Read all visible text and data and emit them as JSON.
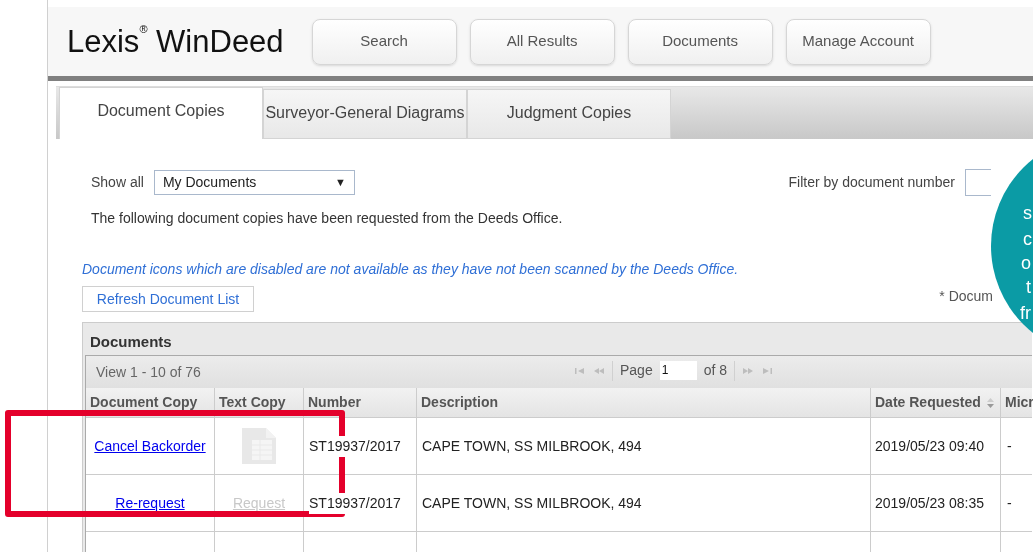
{
  "logo": {
    "name": "Lexis",
    "mark": "®",
    "product": "WinDeed"
  },
  "nav_buttons": [
    "Search",
    "All Results",
    "Documents",
    "Manage Account"
  ],
  "tabs": [
    {
      "label": "Document Copies",
      "selected": true
    },
    {
      "label": "Surveyor-General Diagrams",
      "selected": false
    },
    {
      "label": "Judgment Copies",
      "selected": false
    }
  ],
  "show_all": {
    "label": "Show all",
    "value": "My Documents",
    "caret": "▼"
  },
  "filter": {
    "label": "Filter by document number"
  },
  "intro": "The following document copies have been requested from the Deeds Office.",
  "note": "Document icons which are disabled are not available as they have not been scanned by the Deeds Office.",
  "refresh_button": "Refresh Document List",
  "documents_note": "* Docum",
  "panel": {
    "title": "Documents",
    "view_range": "View 1 - 10 of 76",
    "page_label": "Page",
    "page_value": "1",
    "page_count": "of 8"
  },
  "columns": [
    {
      "label": "Document Copy",
      "sortable": false
    },
    {
      "label": "Text Copy",
      "sortable": false
    },
    {
      "label": "Number",
      "sortable": false
    },
    {
      "label": "Description",
      "sortable": false
    },
    {
      "label": "Date Requested",
      "sortable": true
    },
    {
      "label": "Micr"
    }
  ],
  "rows": [
    {
      "document_copy": "Cancel Backorder",
      "text_copy": {
        "kind": "icon",
        "disabled": true
      },
      "number": "ST19937/2017",
      "description": "CAPE TOWN, SS MILBROOK, 494",
      "date_requested": "2019/05/23 09:40",
      "column_6": "-"
    },
    {
      "document_copy": "Re-request",
      "text_copy": {
        "kind": "link",
        "text": "Request",
        "disabled": true
      },
      "number": "ST19937/2017",
      "description": "CAPE TOWN, SS MILBROOK, 494",
      "date_requested": "2019/05/23 08:35",
      "column_6": "-"
    }
  ],
  "callout": {
    "lines": [
      "s",
      "c",
      "o",
      "t",
      "fr"
    ]
  }
}
